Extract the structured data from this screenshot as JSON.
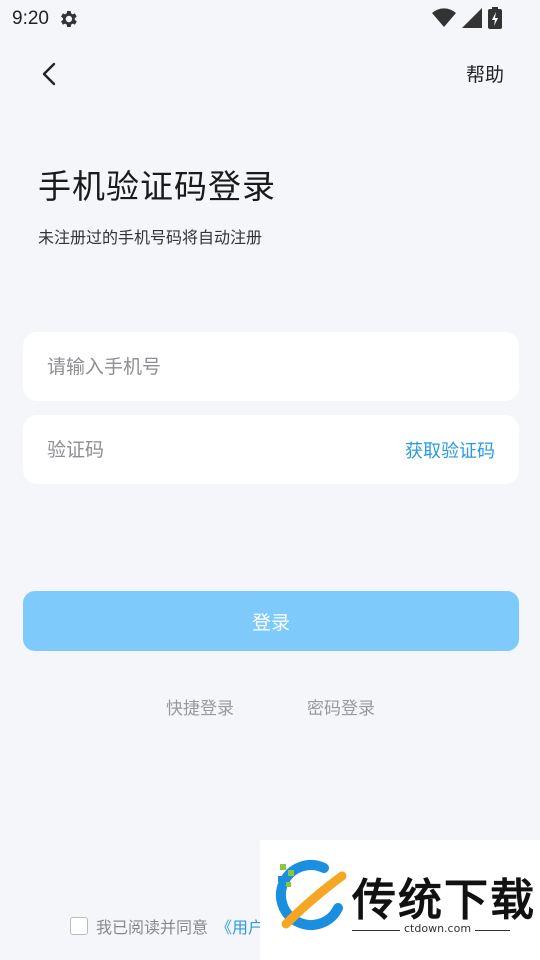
{
  "status_bar": {
    "time": "9:20"
  },
  "header": {
    "help_label": "帮助"
  },
  "content": {
    "title": "手机验证码登录",
    "subtitle": "未注册过的手机号码将自动注册"
  },
  "form": {
    "phone_placeholder": "请输入手机号",
    "phone_value": "",
    "code_placeholder": "验证码",
    "code_value": "",
    "get_code_label": "获取验证码",
    "login_label": "登录"
  },
  "alt_login": {
    "quick_label": "快捷登录",
    "password_label": "密码登录"
  },
  "agreement": {
    "text": "我已阅读并同意",
    "link_visible": "《用户"
  },
  "watermark": {
    "name": "传统下载",
    "domain": "ctdown.com"
  },
  "colors": {
    "background": "#f5f6fa",
    "accent": "#2a9bdf",
    "login_button": "#7ecbfb"
  },
  "icons": {
    "back": "chevron-left-icon",
    "settings": "gear-icon",
    "wifi": "wifi-icon",
    "signal": "signal-icon",
    "battery": "battery-icon"
  }
}
